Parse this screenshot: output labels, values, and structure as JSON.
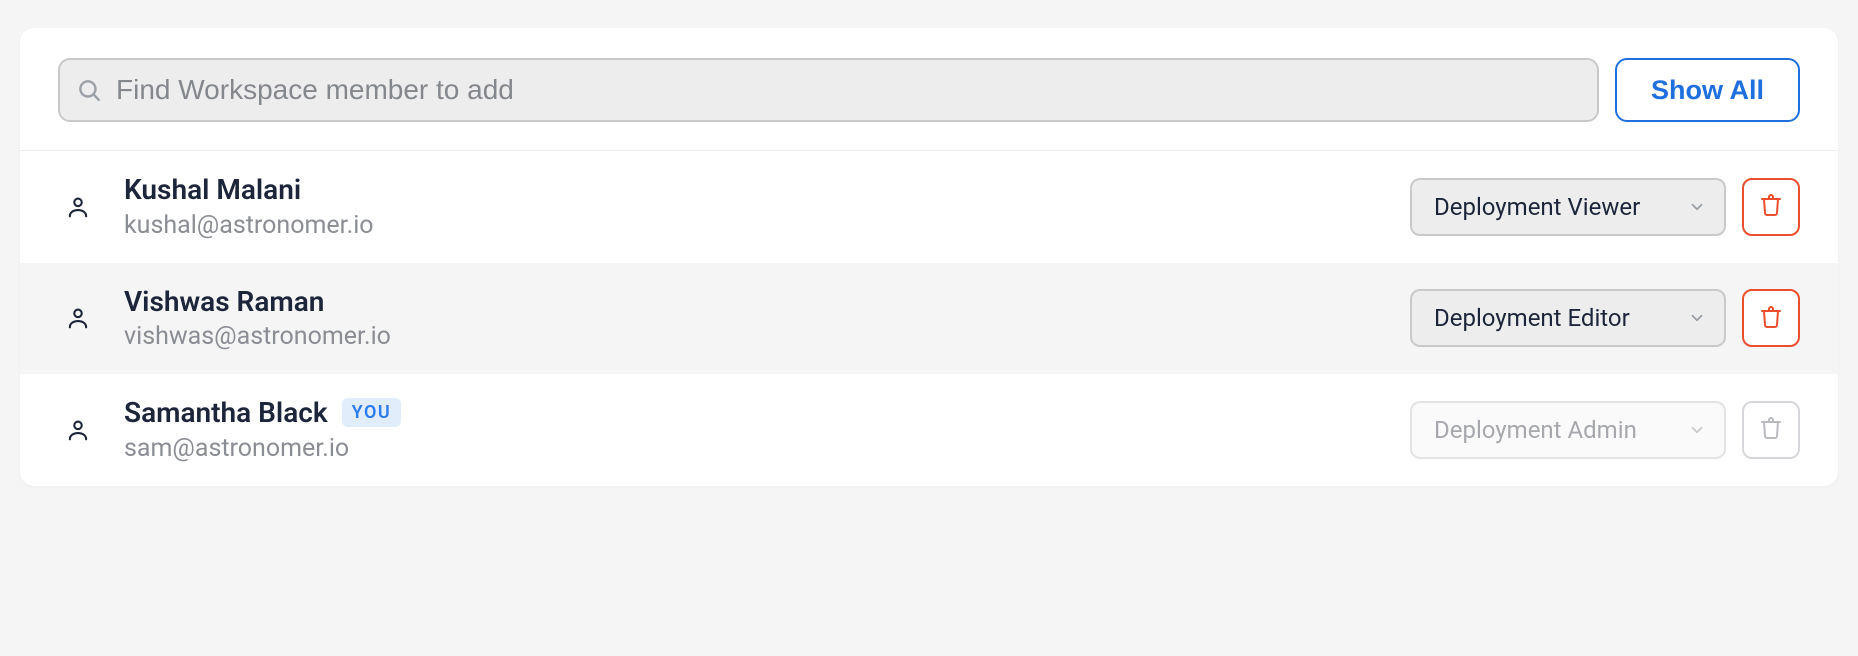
{
  "header": {
    "search_placeholder": "Find Workspace member to add",
    "show_all_label": "Show All"
  },
  "you_badge": "YOU",
  "members": [
    {
      "name": "Kushal Malani",
      "email": "kushal@astronomer.io",
      "role": "Deployment Viewer",
      "is_you": false,
      "disabled": false
    },
    {
      "name": "Vishwas Raman",
      "email": "vishwas@astronomer.io",
      "role": "Deployment Editor",
      "is_you": false,
      "disabled": false
    },
    {
      "name": "Samantha Black",
      "email": "sam@astronomer.io",
      "role": "Deployment Admin",
      "is_you": true,
      "disabled": true
    }
  ]
}
